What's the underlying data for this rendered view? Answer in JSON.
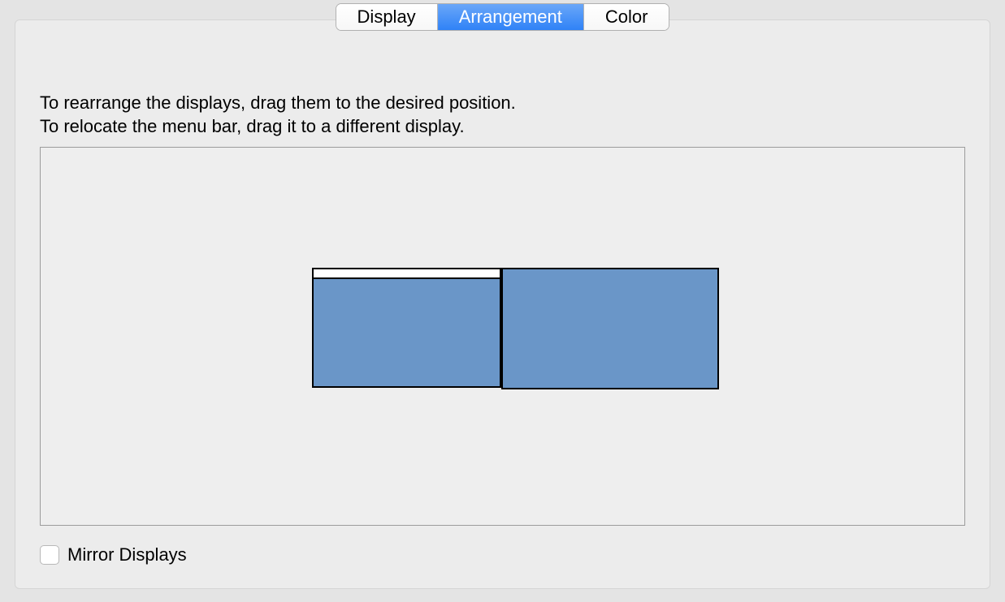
{
  "tabs": {
    "display": "Display",
    "arrangement": "Arrangement",
    "color": "Color",
    "active": "arrangement"
  },
  "instructions": {
    "line1": "To rearrange the displays, drag them to the desired position.",
    "line2": "To relocate the menu bar, drag it to a different display."
  },
  "mirror": {
    "label": "Mirror Displays",
    "checked": false
  },
  "displays": {
    "primary_has_menubar": true,
    "color": "#6a96c8"
  }
}
